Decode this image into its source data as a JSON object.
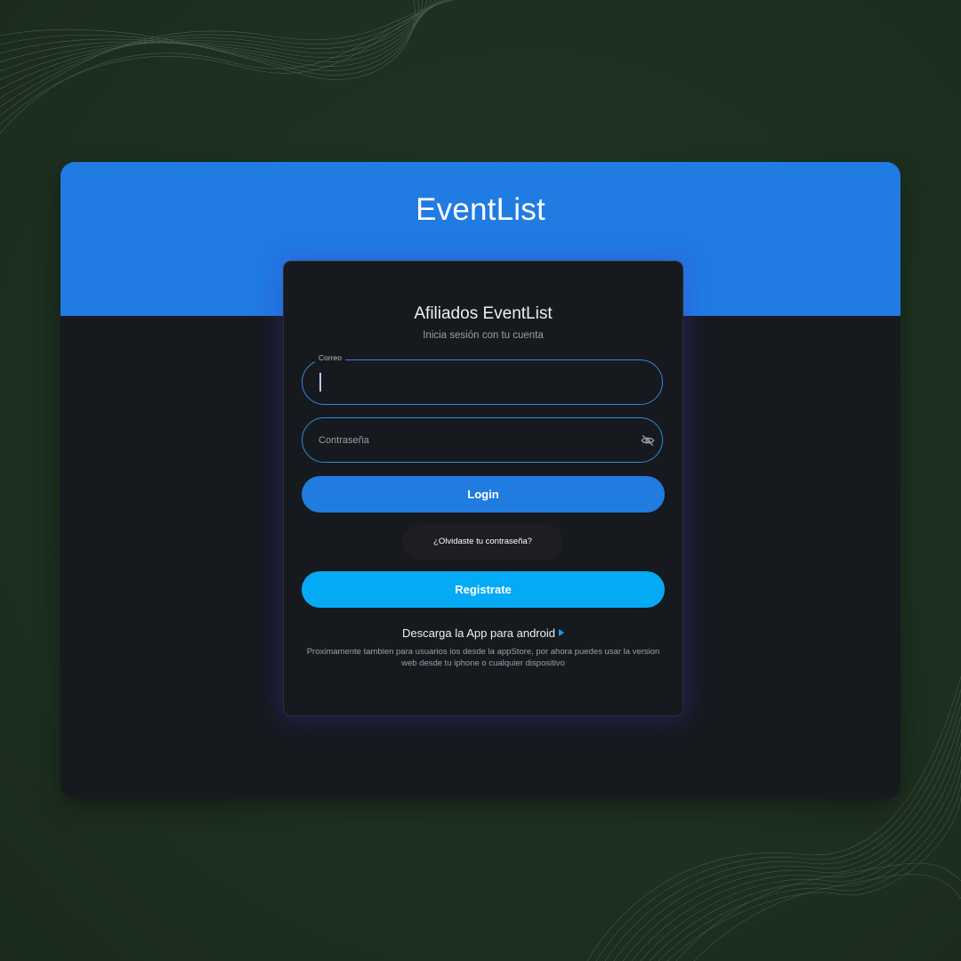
{
  "app": {
    "brand": "EventList"
  },
  "card": {
    "title": "Afiliados EventList",
    "subtitle": "Inicia sesión con tu cuenta"
  },
  "form": {
    "email_label": "Correo",
    "email_value": "",
    "password_placeholder": "Contraseña",
    "password_value": ""
  },
  "actions": {
    "login_label": "Login",
    "forgot_label": "¿Olvidaste tu contraseña?",
    "register_label": "Registrate"
  },
  "download": {
    "link_label": "Descarga la App para android",
    "note": "Proximamente tambien para usuarios ios desde la appStore, por ahora puedes usar la version web desde tu iphone o cualquier dispositivo"
  },
  "icons": {
    "password_toggle": "eye-off-icon",
    "download_arrow": "play-icon"
  },
  "colors": {
    "brand_blue": "#207be3",
    "register_blue": "#05aaf4",
    "card_bg": "#16191d",
    "page_bg": "#1f3221"
  }
}
